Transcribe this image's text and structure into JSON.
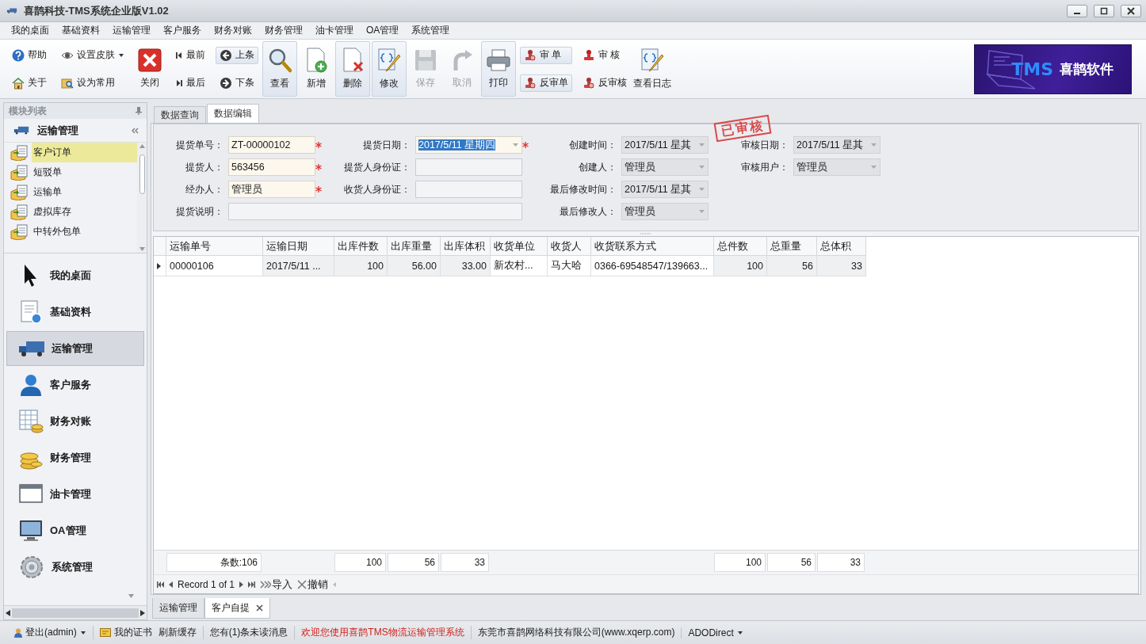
{
  "window": {
    "title": "喜鹊科技-TMS系统企业版V1.02"
  },
  "menu": [
    {
      "label": "我的桌面"
    },
    {
      "label": "基础资料"
    },
    {
      "label": "运输管理"
    },
    {
      "label": "客户服务"
    },
    {
      "label": "财务对账"
    },
    {
      "label": "财务管理"
    },
    {
      "label": "油卡管理"
    },
    {
      "label": "OA管理"
    },
    {
      "label": "系统管理"
    }
  ],
  "toolbar": [
    {
      "kind": "pair",
      "buttons": [
        {
          "label": "帮助",
          "highlighted": false
        },
        {
          "label": "关于",
          "highlighted": false
        }
      ]
    },
    {
      "kind": "pair",
      "buttons": [
        {
          "label": "设置皮肤",
          "highlighted": false,
          "dropdown": true
        },
        {
          "label": "设为常用",
          "highlighted": false
        }
      ]
    },
    {
      "kind": "large",
      "label": "关闭",
      "highlighted": false,
      "disabled": false
    },
    {
      "kind": "pair",
      "buttons": [
        {
          "label": "最前",
          "highlighted": false
        },
        {
          "label": "最后",
          "highlighted": false
        }
      ]
    },
    {
      "kind": "pair",
      "buttons": [
        {
          "label": "上条",
          "highlighted": true
        },
        {
          "label": "下条",
          "highlighted": false
        }
      ]
    },
    {
      "kind": "large",
      "label": "查看",
      "highlighted": true,
      "disabled": false
    },
    {
      "kind": "large",
      "label": "新增",
      "highlighted": false,
      "disabled": false
    },
    {
      "kind": "large",
      "label": "删除",
      "highlighted": true,
      "disabled": false
    },
    {
      "kind": "large",
      "label": "修改",
      "highlighted": true,
      "disabled": false
    },
    {
      "kind": "large",
      "label": "保存",
      "highlighted": false,
      "disabled": true
    },
    {
      "kind": "large",
      "label": "取消",
      "highlighted": false,
      "disabled": true
    },
    {
      "kind": "large",
      "label": "打印",
      "highlighted": true,
      "disabled": false
    },
    {
      "kind": "pair",
      "buttons": [
        {
          "label": "审 单",
          "highlighted": true
        },
        {
          "label": "反审单",
          "highlighted": true
        }
      ]
    },
    {
      "kind": "pair",
      "buttons": [
        {
          "label": "审 核",
          "highlighted": false
        },
        {
          "label": "反审核",
          "highlighted": false
        }
      ]
    },
    {
      "kind": "large",
      "label": "查看日志",
      "highlighted": false,
      "disabled": false
    }
  ],
  "logo": {
    "text_1": "TMS",
    "text_2": "喜鹊软件"
  },
  "sidebar": {
    "title": "模块列表",
    "group": {
      "label": "运输管理"
    },
    "items": [
      {
        "label": "客户订单",
        "selected": true
      },
      {
        "label": "短驳单",
        "selected": false
      },
      {
        "label": "运输单",
        "selected": false
      },
      {
        "label": "虚拟库存",
        "selected": false
      },
      {
        "label": "中转外包单",
        "selected": false
      }
    ],
    "modules": [
      {
        "label": "我的桌面",
        "selected": false
      },
      {
        "label": "基础资料",
        "selected": false
      },
      {
        "label": "运输管理",
        "selected": true
      },
      {
        "label": "客户服务",
        "selected": false
      },
      {
        "label": "财务对账",
        "selected": false
      },
      {
        "label": "财务管理",
        "selected": false
      },
      {
        "label": "油卡管理",
        "selected": false
      },
      {
        "label": "OA管理",
        "selected": false
      },
      {
        "label": "系统管理",
        "selected": false
      }
    ]
  },
  "tabs": [
    {
      "label": "数据查询",
      "selected": false
    },
    {
      "label": "数据编辑",
      "selected": true
    }
  ],
  "form": {
    "stamp": "已审核",
    "columns": [
      [
        {
          "label": "提货单号：",
          "value": "ZT-00000102",
          "kind": "text",
          "required": true,
          "readonly": false
        },
        {
          "label": "提货人：",
          "value": "563456",
          "kind": "text",
          "required": true,
          "readonly": false
        },
        {
          "label": "经办人：",
          "value": "管理员",
          "kind": "text",
          "required": true,
          "readonly": false
        },
        {
          "label": "提货说明：",
          "kind": "text",
          "required": false,
          "readonly": false
        }
      ],
      [
        {
          "label": "提货日期：",
          "value": "2017/5/11 星期四",
          "kind": "date",
          "required": true,
          "readonly": false,
          "text_selected": true
        },
        {
          "label": "提货人身份证：",
          "kind": "text",
          "required": false,
          "readonly": false
        },
        {
          "label": "收货人身份证：",
          "kind": "text",
          "required": false,
          "readonly": false
        }
      ],
      [
        {
          "label": "创建时间：",
          "value": "2017/5/11 星其",
          "kind": "date",
          "required": false,
          "readonly": true
        },
        {
          "label": "创建人：",
          "value": "管理员",
          "kind": "date",
          "required": false,
          "readonly": true
        },
        {
          "label": "最后修改时间：",
          "value": "2017/5/11 星其",
          "kind": "date",
          "required": false,
          "readonly": true
        },
        {
          "label": "最后修改人：",
          "value": "管理员",
          "kind": "date",
          "required": false,
          "readonly": true
        }
      ],
      [
        {
          "label": "审核日期：",
          "value": "2017/5/11 星其",
          "kind": "date",
          "required": false,
          "readonly": true
        },
        {
          "label": "审核用户：",
          "value": "管理员",
          "kind": "date",
          "required": false,
          "readonly": true
        }
      ]
    ]
  },
  "table": {
    "columns": [
      {
        "label": "运输单号",
        "numeric": false,
        "readonly": false
      },
      {
        "label": "运输日期",
        "numeric": false,
        "readonly": true
      },
      {
        "label": "出库件数",
        "numeric": true,
        "readonly": true
      },
      {
        "label": "出库重量",
        "numeric": true,
        "readonly": true
      },
      {
        "label": "出库体积",
        "numeric": true,
        "readonly": true
      },
      {
        "label": "收货单位",
        "numeric": false,
        "readonly": false
      },
      {
        "label": "收货人",
        "numeric": false,
        "readonly": false
      },
      {
        "label": "收货联系方式",
        "numeric": false,
        "readonly": false
      },
      {
        "label": "总件数",
        "numeric": true,
        "readonly": true
      },
      {
        "label": "总重量",
        "numeric": true,
        "readonly": true
      },
      {
        "label": "总体积",
        "numeric": true,
        "readonly": true
      }
    ],
    "rows": [
      {
        "current": true,
        "cells": [
          "00000106",
          "2017/5/11 ...",
          "100",
          "56.00",
          "33.00",
          "新农村...",
          "马大哈",
          "0366-69548547/139663...",
          "100",
          "56",
          "33"
        ]
      }
    ],
    "summary": {
      "count": "条数:106",
      "outbound_totals": [
        "100",
        "56",
        "33"
      ],
      "totals": [
        "100",
        "56",
        "33"
      ]
    },
    "navigator": {
      "record": "Record 1 of 1",
      "import": "导入",
      "cancel": "撤销"
    }
  },
  "doc_tabs": [
    {
      "label": "运输管理",
      "selected": false,
      "closable": false
    },
    {
      "label": "客户自提",
      "selected": true,
      "closable": true
    }
  ],
  "status_bar": [
    {
      "label": "登出(admin)",
      "kind": "user"
    },
    {
      "label": "我的证书",
      "kind": "cert"
    },
    {
      "label": "刷新缓存",
      "kind": "plain"
    },
    {
      "label": "您有(1)条未读消息",
      "kind": "plain"
    },
    {
      "label": "欢迎您使用喜鹊TMS物流运输管理系统",
      "kind": "notice"
    },
    {
      "label": "东莞市喜鹊网络科技有限公司(www.xqerp.com)",
      "kind": "plain"
    },
    {
      "label": "ADODirect",
      "kind": "menu"
    }
  ]
}
